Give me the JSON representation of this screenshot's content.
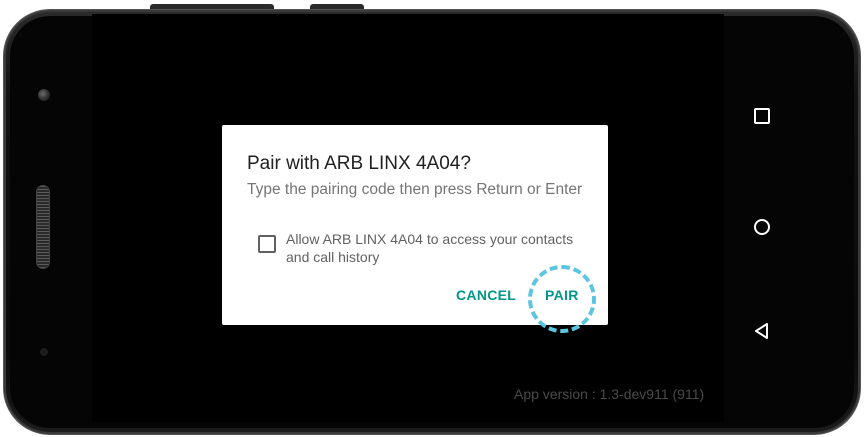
{
  "dialog": {
    "title": "Pair with ARB LINX 4A04?",
    "message": "Type the pairing code then press Return or Enter",
    "checkbox_label": "Allow ARB LINX 4A04 to access your contacts and call history",
    "checkbox_checked": false,
    "cancel_label": "CANCEL",
    "pair_label": "PAIR"
  },
  "footer": {
    "app_version": "App version : 1.3-dev911 (911)"
  },
  "navigation": {
    "recents_icon": "square-icon",
    "home_icon": "circle-icon",
    "back_icon": "triangle-back-icon"
  },
  "colors": {
    "accent": "#009688",
    "highlight": "#5bc5e0",
    "screen_background": "#000000",
    "dialog_background": "#ffffff"
  }
}
